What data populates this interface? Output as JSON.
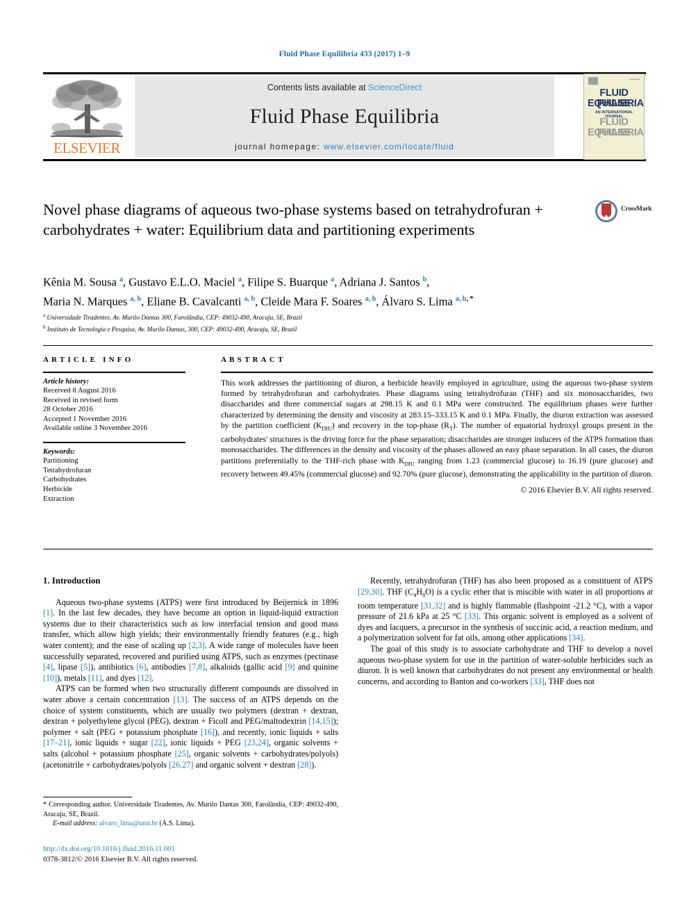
{
  "running_head": "Fluid Phase Equilibria 433 (2017) 1–9",
  "masthead": {
    "contents_prefix": "Contents lists available at",
    "sciencedirect": "ScienceDirect",
    "journal_name": "Fluid Phase Equilibria",
    "homepage_label": "journal homepage:",
    "homepage_url": "www.elsevier.com/locate/fluid",
    "publisher": "ELSEVIER",
    "cover": {
      "line1": "FLUID PHASE",
      "line2": "EQUILIBRIA",
      "subtitle": "AN INTERNATIONAL JOURNAL",
      "line3": "FLUID PHASE",
      "line4": "EQUILIBRIA",
      "corner_text": "ELSEVIER"
    },
    "accent_link_color": "#2b9fd8",
    "elsevier_orange": "#e87722"
  },
  "crossmark": {
    "label": "CrossMark"
  },
  "article": {
    "title": "Novel phase diagrams of aqueous two-phase systems based on tetrahydrofuran + carbohydrates + water: Equilibrium data and partitioning experiments",
    "authors_line1": "Kênia M. Sousa a, Gustavo E.L.O. Maciel a, Filipe S. Buarque a, Adriana J. Santos b,",
    "authors_line2": "Maria N. Marques a, b, Eliane B. Cavalcanti a, b, Cleide Mara F. Soares a, b, Álvaro S. Lima a, b, *",
    "affiliation_a": "Universidade Tiradentes, Av. Murilo Dantas 300, Farolândia, CEP: 49032-490, Aracaju, SE, Brazil",
    "affiliation_b": "Instituto de Tecnologia e Pesquisa, Av. Murilo Dantas, 300, CEP: 49032-490, Aracaju, SE, Brazil"
  },
  "article_info": {
    "heading": "ARTICLE INFO",
    "history_label": "Article history:",
    "history": [
      "Received 8 August 2016",
      "Received in revised form",
      "28 October 2016",
      "Accepted 1 November 2016",
      "Available online 3 November 2016"
    ],
    "keywords_label": "Keywords:",
    "keywords": [
      "Partitioning",
      "Tetrahydrofuran",
      "Carbohydrates",
      "Herbicide",
      "Extraction"
    ]
  },
  "abstract": {
    "heading": "ABSTRACT",
    "part1": "This work addresses the partitioning of diuron, a herbicide heavily employed in agriculture, using the aqueous two-phase system formed by tetrahydrofuran and carbohydrates. Phase diagrams using tetrahydrofuran (THF) and six monosaccharides, two disaccharides and three commercial sugars at 298.15 K and 0.1 MPa were constructed. The equilibrium phases were further characterized by determining the density and viscosity at 283.15–333.15 K and 0.1 MPa. Finally, the diuron extraction was assessed by the partition coefficient (K",
    "sub1": "DIU",
    "part2": ") and recovery in the top-phase (R",
    "sub2": "T",
    "part3": "). The number of equatorial hydroxyl groups present in the carbohydrates' structures is the driving force for the phase separation; disaccharides are stronger inducers of the ATPS formation than monosaccharides. The differences in the density and viscosity of the phases allowed an easy phase separation. In all cases, the diuron partitions preferentially to the THF-rich phase with K",
    "sub3": "DIU",
    "part4": " ranging from 1.23 (commercial glucose) to 16.19 (pure glucose) and recovery between 49.45% (commercial glucose) and 92.70% (pure glucose), demonstrating the applicability in the partition of diuron.",
    "copyright": "© 2016 Elsevier B.V. All rights reserved."
  },
  "introduction": {
    "heading": "1. Introduction",
    "p1_a": "Aqueous two-phase systems (ATPS) were first introduced by Beijernick in 1896 ",
    "p1_r1": "[1]",
    "p1_b": ". In the last few decades, they have become an option in liquid-liquid extraction systems due to their characteristics such as low interfacial tension and good mass transfer, which allow high yields; their environmentally friendly features (e.g., high water content); and the ease of scaling up ",
    "p1_r2": "[2,3]",
    "p1_c": ". A wide range of molecules have been successfully separated, recovered and purified using ATPS, such as enzymes (pectinase ",
    "p1_r3": "[4]",
    "p1_d": ", lipase ",
    "p1_r4": "[5]",
    "p1_e": "), antibiotics ",
    "p1_r5": "[6]",
    "p1_f": ", antibodies ",
    "p1_r6": "[7,8]",
    "p1_g": ", alkaloids (gallic acid ",
    "p1_r7": "[9]",
    "p1_h": " and quinine ",
    "p1_r8": "[10]",
    "p1_i": "), metals ",
    "p1_r9": "[11]",
    "p1_j": ", and dyes ",
    "p1_r10": "[12]",
    "p1_k": ".",
    "p2_a": "ATPS can be formed when two structurally different compounds are dissolved in water above a certain concentration ",
    "p2_r1": "[13]",
    "p2_b": ". The success of an ATPS depends on the choice of system constituents, which are usually two polymers (dextran + dextran, dextran + polyethylene glycol (PEG), dextran + Ficoll and PEG/maltodextrin ",
    "p2_r2": "[14,15]",
    "p2_c": "); polymer + salt (PEG + potassium phosphate ",
    "p2_r3": "[16]",
    "p2_d": "), and recently, ionic liquids + salts ",
    "p2_r4": "[17–21]",
    "p2_e": ", ionic liquids + sugar ",
    "p2_r5": "[22]",
    "p2_f": ", ionic liquids + PEG ",
    "p2_r6": "[23,24]",
    "p2_g": ", organic solvents + salts (alcohol + potassium phosphate ",
    "p2_r7": "[25]",
    "p2_h": ", organic solvents + carbohydrates/polyols) (acetonitrile + carbohydrates/polyols ",
    "p2_r8": "[26,27]",
    "p2_i": " and organic solvent + dextran ",
    "p2_r9": "[28]",
    "p2_j": ").",
    "p3_a": "Recently, tetrahydrofuran (THF) has also been proposed as a constituent of ATPS ",
    "p3_r1": "[29,30]",
    "p3_b": ". THF (C",
    "p3_sub1": "4",
    "p3_c": "H",
    "p3_sub2": "8",
    "p3_d": "O) is a cyclic ether that is miscible with water in all proportions at room temperature ",
    "p3_r2": "[31,32]",
    "p3_e": " and is highly flammable (flashpoint -21.2 °C), with a vapor pressure of 21.6 kPa at 25 °C ",
    "p3_r3": "[33]",
    "p3_f": ". This organic solvent is employed as a solvent of dyes and lacquers, a precursor in the synthesis of succinic acid, a reaction medium, and a polymerization solvent for fat oils, among other applications ",
    "p3_r4": "[34]",
    "p3_g": ".",
    "p4_a": "The goal of this study is to associate carbohydrate and THF to develop a novel aqueous two-phase system for use in the partition of water-soluble herbicides such as diuron. It is well known that carbohydrates do not present any environmental or health concerns, and according to Banton and co-workers ",
    "p4_r1": "[33]",
    "p4_b": ", THF does not"
  },
  "footer": {
    "corresponding_mark": "*",
    "corresponding_text": "Corresponding author. Universidade Tiradentes, Av. Murilo Dantas 300, Farolândia, CEP: 49032-490, Aracaju, SE, Brazil.",
    "email_label": "E-mail address:",
    "email": "alvaro_lima@unit.br",
    "email_owner": "(Á.S. Lima).",
    "doi": "http://dx.doi.org/10.1016/j.fluid.2016.11.001",
    "issn_line": "0378-3812/© 2016 Elsevier B.V. All rights reserved."
  }
}
